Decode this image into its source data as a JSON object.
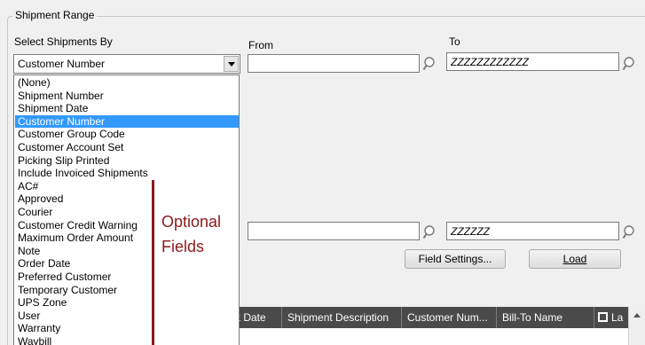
{
  "group": {
    "title": "Shipment Range"
  },
  "select_by": {
    "label": "Select Shipments By",
    "value": "Customer Number"
  },
  "range": {
    "from_label": "From",
    "to_label": "To",
    "row1": {
      "from_value": "",
      "to_value": "ZZZZZZZZZZZZ"
    },
    "row2": {
      "from_value": "",
      "to_value": "ZZZZZZ"
    }
  },
  "dropdown": {
    "items": [
      "(None)",
      "Shipment Number",
      "Shipment Date",
      "Customer Number",
      "Customer Group Code",
      "Customer Account Set",
      "Picking Slip Printed",
      "Include Invoiced Shipments",
      "AC#",
      "Approved",
      "Courier",
      "Customer Credit Warning",
      "Maximum Order Amount",
      "Note",
      "Order Date",
      "Preferred Customer",
      "Temporary Customer",
      "UPS Zone",
      "User",
      "Warranty",
      "Waybill"
    ],
    "selected": "Customer Number"
  },
  "annotation": {
    "line1": "Optional",
    "line2": "Fields"
  },
  "buttons": {
    "field_settings": "Field Settings...",
    "load": "Load"
  },
  "grid": {
    "columns": [
      "nt Date",
      "Shipment Description",
      "Customer Num...",
      "Bill-To Name",
      "La"
    ]
  },
  "colors": {
    "selection": "#3399ff",
    "annotation": "#8b1a1a",
    "grid_header": "#4a4a4a"
  }
}
